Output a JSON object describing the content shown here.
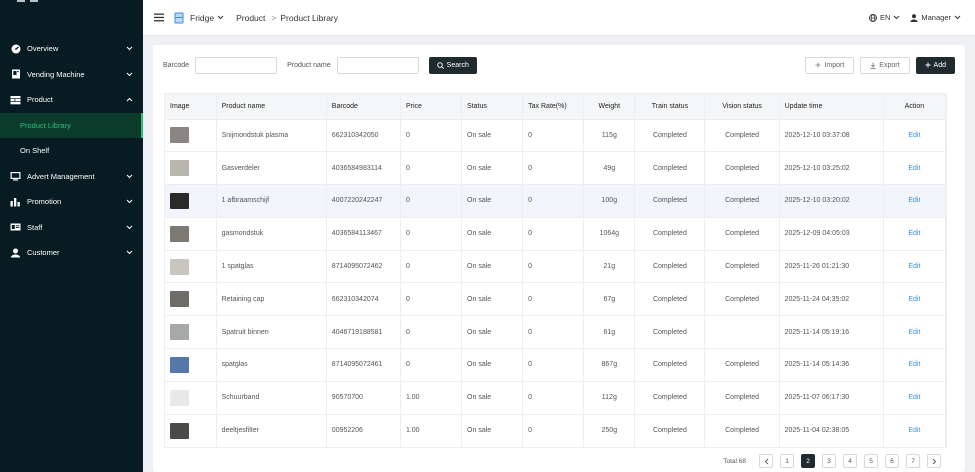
{
  "header": {
    "store": "Fridge",
    "breadcrumb": [
      "Product",
      "Product Library"
    ],
    "breadcrumb_sep": ">",
    "language": "EN",
    "user": "Manager"
  },
  "sidebar": {
    "items": [
      {
        "label": "Overview",
        "icon": "dashboard-icon"
      },
      {
        "label": "Vending Machine",
        "icon": "machine-icon"
      },
      {
        "label": "Product",
        "icon": "product-icon",
        "expanded": true
      },
      {
        "label": "Product Library",
        "sub": true,
        "active": true
      },
      {
        "label": "On Shelf",
        "sub": true
      },
      {
        "label": "Advert Management",
        "icon": "advert-icon"
      },
      {
        "label": "Promotion",
        "icon": "chart-icon"
      },
      {
        "label": "Staff",
        "icon": "staff-icon"
      },
      {
        "label": "Customer",
        "icon": "customer-icon"
      }
    ]
  },
  "filters": {
    "barcode_label": "Barcode",
    "barcode_value": "",
    "name_label": "Product name",
    "name_value": "",
    "search_label": "Search"
  },
  "actions": {
    "import_label": "Import",
    "export_label": "Export",
    "add_label": "Add"
  },
  "table": {
    "columns": [
      "Image",
      "Product name",
      "Barcode",
      "Price",
      "Status",
      "Tax Rate(%)",
      "Weight",
      "Train status",
      "Vision status",
      "Update time",
      "Action"
    ],
    "rows": [
      {
        "name": "Snijmondstuk plasma",
        "barcode": "662310342050",
        "price": "0",
        "status": "On sale",
        "tax": "0",
        "weight": "115g",
        "train": "Completed",
        "vision": "Completed",
        "updated": "2025-12-10 03:37:08",
        "action": "Edit",
        "thumb": "#8a8580"
      },
      {
        "name": "Gasverdeler",
        "barcode": "4036584983114",
        "price": "0",
        "status": "On sale",
        "tax": "0",
        "weight": "49g",
        "train": "Completed",
        "vision": "Completed",
        "updated": "2025-12-10 03:25:02",
        "action": "Edit",
        "thumb": "#b9b6b0"
      },
      {
        "name": "1 afbraamschijf",
        "barcode": "4007220242247",
        "price": "0",
        "status": "On sale",
        "tax": "0",
        "weight": "100g",
        "train": "Completed",
        "vision": "Completed",
        "updated": "2025-12-10 03:20:02",
        "action": "Edit",
        "thumb": "#2a2a2a"
      },
      {
        "name": "gasmondstuk",
        "barcode": "4036584113467",
        "price": "0",
        "status": "On sale",
        "tax": "0",
        "weight": "1064g",
        "train": "Completed",
        "vision": "Completed",
        "updated": "2025-12-09 04:05:03",
        "action": "Edit",
        "thumb": "#7d7a74"
      },
      {
        "name": "1 spatglas",
        "barcode": "8714095072462",
        "price": "0",
        "status": "On sale",
        "tax": "0",
        "weight": "21g",
        "train": "Completed",
        "vision": "Completed",
        "updated": "2025-11-26 01:21:30",
        "action": "Edit",
        "thumb": "#c9c6c0"
      },
      {
        "name": "Retaining cap",
        "barcode": "662310342074",
        "price": "0",
        "status": "On sale",
        "tax": "0",
        "weight": "67g",
        "train": "Completed",
        "vision": "Completed",
        "updated": "2025-11-24 04:35:02",
        "action": "Edit",
        "thumb": "#6f6c68"
      },
      {
        "name": "Spatruit binnen",
        "barcode": "4046719188581",
        "price": "0",
        "status": "On sale",
        "tax": "0",
        "weight": "61g",
        "train": "Completed",
        "vision": "",
        "updated": "2025-11-14 05:19:16",
        "action": "Edit",
        "thumb": "#a6a8aa"
      },
      {
        "name": "spatglas",
        "barcode": "8714095072461",
        "price": "0",
        "status": "On sale",
        "tax": "0",
        "weight": "867g",
        "train": "Completed",
        "vision": "Completed",
        "updated": "2025-11-14 05:14:36",
        "action": "Edit",
        "thumb": "#5577aa"
      },
      {
        "name": "Schuurband",
        "barcode": "90570700",
        "price": "1.00",
        "status": "On sale",
        "tax": "0",
        "weight": "112g",
        "train": "Completed",
        "vision": "Completed",
        "updated": "2025-11-07 06:17:30",
        "action": "Edit",
        "thumb": "#e8e8e8"
      },
      {
        "name": "deeltjesfilter",
        "barcode": "00952206",
        "price": "1.00",
        "status": "On sale",
        "tax": "0",
        "weight": "250g",
        "train": "Completed",
        "vision": "Completed",
        "updated": "2025-11-04 02:38:05",
        "action": "Edit",
        "thumb": "#4a4a48"
      }
    ]
  },
  "pagination": {
    "total_label": "Total 68",
    "pages": [
      "1",
      "2",
      "3",
      "4",
      "5",
      "6",
      "7"
    ],
    "current": "2"
  },
  "colors": {
    "sidebar_bg": "#061c22",
    "accent_green": "#27c27a",
    "primary_dark": "#1f2a2e",
    "link_blue": "#3a8ee6"
  }
}
